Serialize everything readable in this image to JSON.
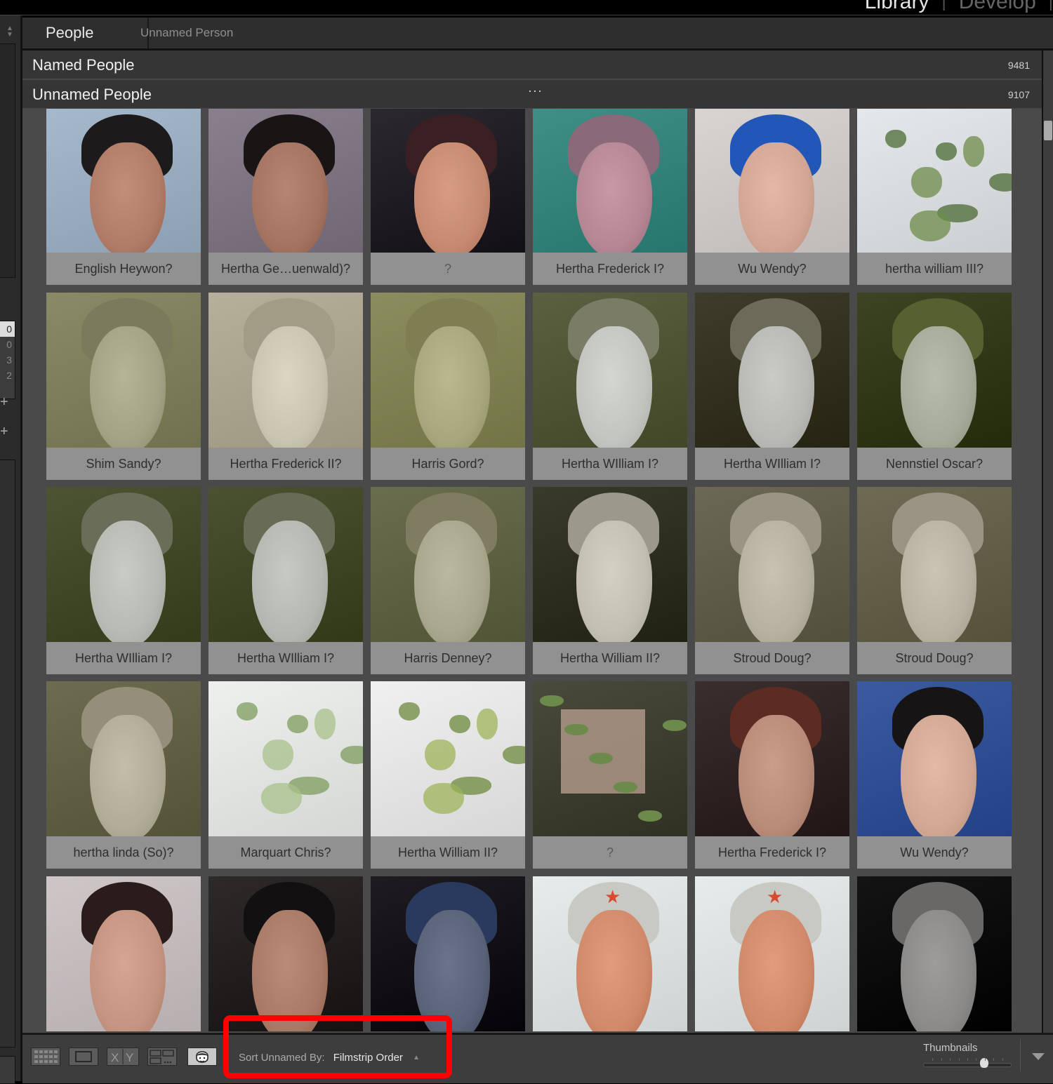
{
  "modules": {
    "items": [
      {
        "label": "Library",
        "active": true
      },
      {
        "label": "Develop",
        "active": false
      }
    ],
    "separator": "|"
  },
  "left_panel": {
    "list_values": [
      "0",
      "0",
      "3",
      "2"
    ],
    "plus_label": "+"
  },
  "header": {
    "crumb_root": "People",
    "crumb_sub": "Unnamed Person"
  },
  "sections": {
    "named": {
      "title": "Named People",
      "count": "9481"
    },
    "unnamed": {
      "title": "Unnamed People",
      "count": "9107",
      "more": "···"
    }
  },
  "faces": [
    {
      "label": "English Heywon?",
      "kind": "person",
      "bg": "#a6b8cc",
      "skin": "#b07c68",
      "hair": "#1d1a1c"
    },
    {
      "label": "Hertha Ge…uenwald)?",
      "kind": "person",
      "bg": "#8a7f8c",
      "skin": "#a47461",
      "hair": "#191514"
    },
    {
      "label": "?",
      "kind": "person",
      "bg": "#2c2830",
      "skin": "#c58a70",
      "hair": "#3a2022"
    },
    {
      "label": "Hertha Frederick I?",
      "kind": "person",
      "bg": "#3f8f86",
      "skin": "#b58794",
      "hair": "#8a6a78"
    },
    {
      "label": "Wu Wendy?",
      "kind": "person",
      "bg": "#d9d4d2",
      "skin": "#d3a595",
      "hair": "#2257b8"
    },
    {
      "label": "hertha william III?",
      "kind": "foliage",
      "bg": "#e4e8ea",
      "skin": "#6d8c4a",
      "hair": "#4c6b34"
    },
    {
      "label": "Shim Sandy?",
      "kind": "statue",
      "bg": "#8a8a66",
      "skin": "#a4a284",
      "hair": "#7c7a5c"
    },
    {
      "label": "Hertha Frederick II?",
      "kind": "statue",
      "bg": "#b6b09a",
      "skin": "#c9c4b0",
      "hair": "#a29c86"
    },
    {
      "label": "Harris Gord?",
      "kind": "statue",
      "bg": "#8c8d5e",
      "skin": "#a7a67c",
      "hair": "#7e7e52"
    },
    {
      "label": "Hertha WIlliam I?",
      "kind": "statue",
      "bg": "#5a6040",
      "skin": "#c2c4c0",
      "hair": "#7a7c66"
    },
    {
      "label": "Hertha WIlliam I?",
      "kind": "statue",
      "bg": "#3e3c2a",
      "skin": "#b8b8b4",
      "hair": "#6c6a58"
    },
    {
      "label": "Nennstiel Oscar?",
      "kind": "statue",
      "bg": "#3c4424",
      "skin": "#a6aa98",
      "hair": "#566030"
    },
    {
      "label": "Hertha WIlliam I?",
      "kind": "statue",
      "bg": "#4c5434",
      "skin": "#b6bab2",
      "hair": "#6a6e58"
    },
    {
      "label": "Hertha WIlliam I?",
      "kind": "statue",
      "bg": "#4a5232",
      "skin": "#b4b8b0",
      "hair": "#686c56"
    },
    {
      "label": "Harris Denney?",
      "kind": "statue",
      "bg": "#6a6e4e",
      "skin": "#a8a68c",
      "hair": "#807c62"
    },
    {
      "label": "Hertha William II?",
      "kind": "statue",
      "bg": "#3a3a2a",
      "skin": "#c2bfb2",
      "hair": "#9c988a"
    },
    {
      "label": "Stroud Doug?",
      "kind": "statue",
      "bg": "#6c6856",
      "skin": "#b6b0a0",
      "hair": "#9a9484"
    },
    {
      "label": "Stroud Doug?",
      "kind": "statue",
      "bg": "#6e6a54",
      "skin": "#b8b2a2",
      "hair": "#9a9484"
    },
    {
      "label": "hertha linda (So)?",
      "kind": "statue",
      "bg": "#6e6c50",
      "skin": "#b0ac98",
      "hair": "#948e7a"
    },
    {
      "label": "Marquart Chris?",
      "kind": "foliage",
      "bg": "#eef0ee",
      "skin": "#a8c08a",
      "hair": "#7e9c5c"
    },
    {
      "label": "Hertha William II?",
      "kind": "foliage",
      "bg": "#f0f0f0",
      "skin": "#9cb45a",
      "hair": "#6c8a3c"
    },
    {
      "label": "?",
      "kind": "water",
      "bg": "#4a4a3c",
      "skin": "#b49c8c",
      "hair": "#6c8a4c"
    },
    {
      "label": "Hertha Frederick I?",
      "kind": "person",
      "bg": "#3a2e2e",
      "skin": "#b88a78",
      "hair": "#5c2c22"
    },
    {
      "label": "Wu Wendy?",
      "kind": "person",
      "bg": "#3c5aa0",
      "skin": "#d0a894",
      "hair": "#161414"
    },
    {
      "label": "",
      "kind": "person",
      "bg": "#cfc6c8",
      "skin": "#c49480",
      "hair": "#2a1c1a"
    },
    {
      "label": "",
      "kind": "person",
      "bg": "#2e2a2a",
      "skin": "#a87a66",
      "hair": "#121010"
    },
    {
      "label": "",
      "kind": "person",
      "bg": "#1e1c20",
      "skin": "#5a6278",
      "hair": "#2a3a5e"
    },
    {
      "label": "",
      "kind": "poster",
      "bg": "#e6ecec",
      "skin": "#d08a6a",
      "hair": "#c9c9c4"
    },
    {
      "label": "",
      "kind": "poster",
      "bg": "#e6ecec",
      "skin": "#d08a6a",
      "hair": "#c9c9c4"
    },
    {
      "label": "",
      "kind": "statue",
      "bg": "#141414",
      "skin": "#8c8a88",
      "hair": "#6a6866"
    }
  ],
  "toolbar": {
    "view_buttons": [
      {
        "name": "grid-view",
        "active": false
      },
      {
        "name": "loupe-view",
        "active": false
      },
      {
        "name": "compare-view",
        "active": false
      },
      {
        "name": "survey-view",
        "active": false
      },
      {
        "name": "people-view",
        "active": true
      }
    ],
    "compare_x": "X",
    "compare_y": "Y",
    "sort_label": "Sort Unnamed By:",
    "sort_value": "Filmstrip Order",
    "thumbnails_label": "Thumbnails",
    "thumbnails_value": 0.69
  },
  "colors": {
    "highlight": "#ff0000",
    "panel_bg": "#4a4a4a",
    "label_bg": "#919191"
  }
}
